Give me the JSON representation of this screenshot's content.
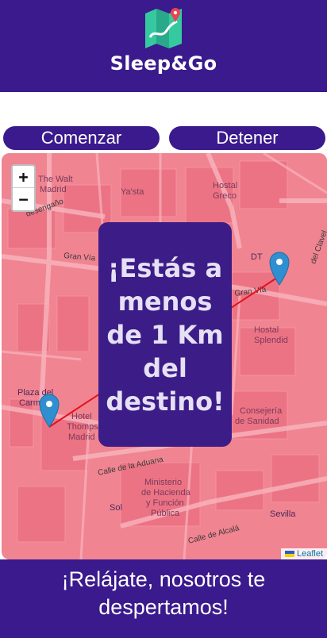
{
  "header": {
    "app_name": "Sleep&Go",
    "logo_icon": "map-pin-icon"
  },
  "controls": {
    "start_label": "Comenzar",
    "stop_label": "Detener"
  },
  "map": {
    "zoom_in": "+",
    "zoom_out": "−",
    "attribution": "Leaflet",
    "places": {
      "walt": "The Walt",
      "madrid1": "Madrid",
      "yasta": "Ya'sta",
      "hostal": "Hostal",
      "greco": "Greco",
      "gran_via_1": "Gran Vía",
      "gran_via_2": "Gran Vía",
      "plaza": "Plaza del",
      "carmen": "Carm",
      "hotel": "Hotel",
      "thompson": "Thompso",
      "madrid2": "Madrid",
      "consejeria": "Consejería",
      "sanidad": "de Sanidad",
      "hostal2": "Hostal",
      "splendid": "Splendid",
      "aduana": "Calle de la Aduana",
      "ministerio1": "Ministerio",
      "ministerio2": "de Hacienda",
      "ministerio3": "y Función",
      "ministerio4": "Pública",
      "alcala": "Calle de Alcalá",
      "sevilla": "Sevilla",
      "sol": "Sol",
      "desengano": "desengaño",
      "claver": "del Clavel",
      "dt": "DT"
    },
    "colors": {
      "tint": "#ef5a6f",
      "pin": "#2f8fd0",
      "route": "#e3121f"
    }
  },
  "alert": {
    "message": "¡Estás a menos de 1 Km del destino!"
  },
  "footer": {
    "message": "¡Relájate, nosotros te despertamos!"
  }
}
